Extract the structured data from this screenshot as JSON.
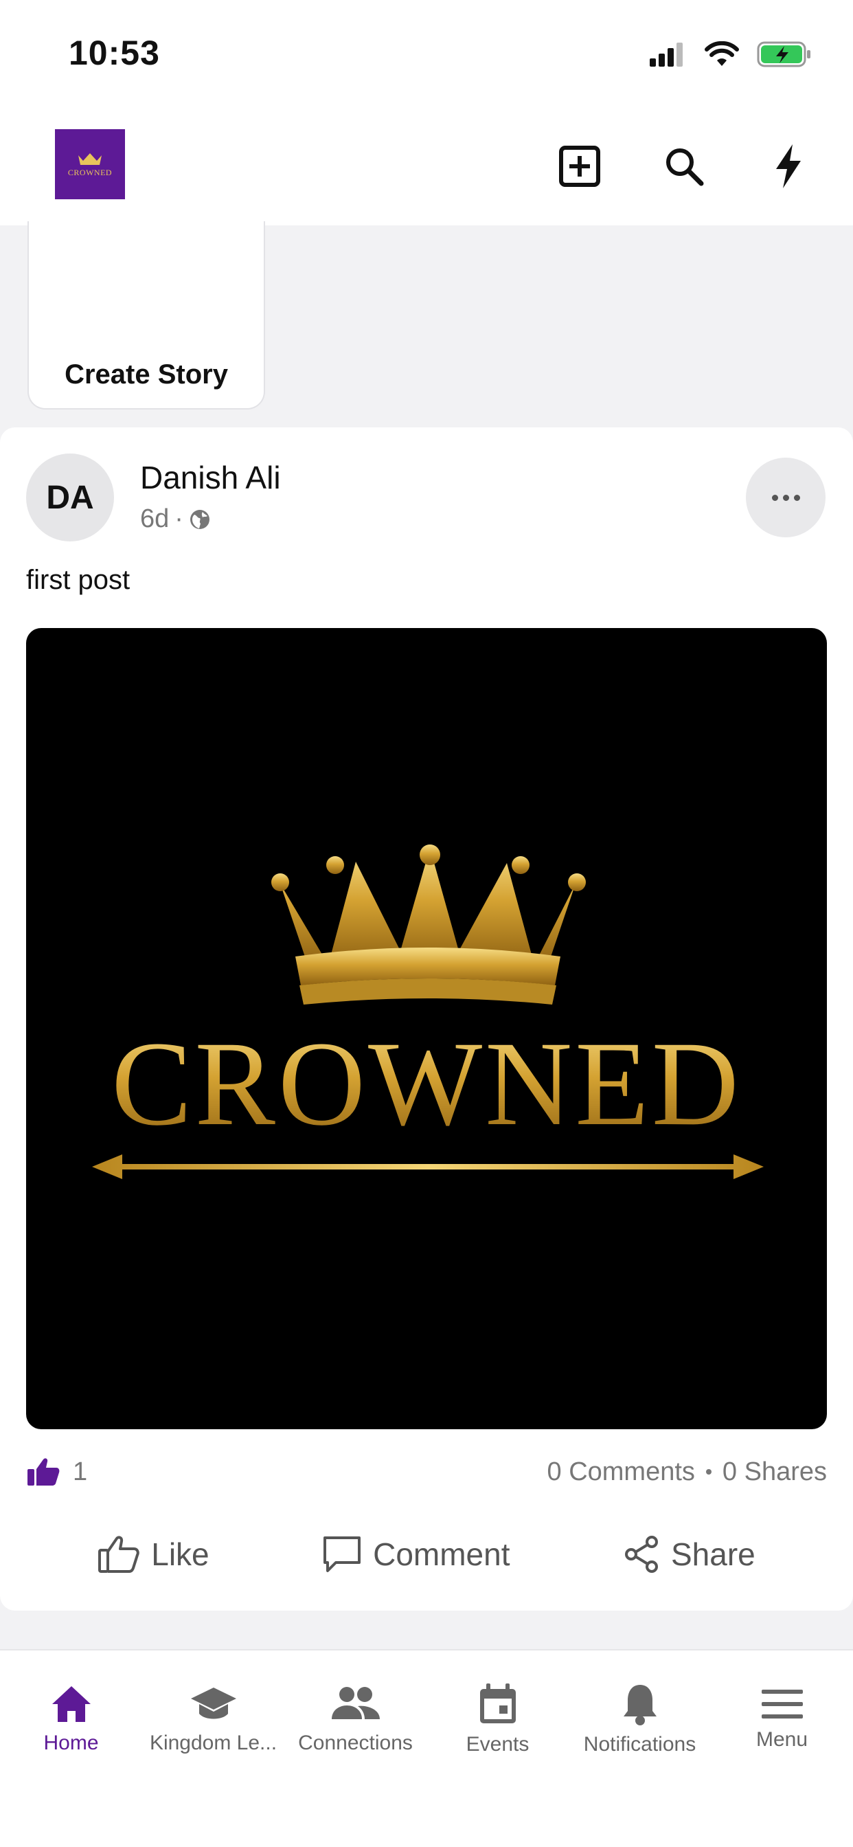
{
  "status_bar": {
    "time": "10:53"
  },
  "header": {
    "logo_text": "CROWNED",
    "actions": [
      "add-post",
      "search",
      "flash"
    ]
  },
  "stories": {
    "create_label": "Create Story"
  },
  "post": {
    "avatar_initials": "DA",
    "author": "Danish Ali",
    "age": "6d",
    "visibility": "public",
    "text": "first post",
    "image_text": "CROWNED",
    "likes": "1",
    "comments": "0 Comments",
    "shares": "0 Shares",
    "actions": {
      "like": "Like",
      "comment": "Comment",
      "share": "Share"
    }
  },
  "tab_bar": {
    "active": "Home",
    "tabs": [
      {
        "label": "Home",
        "icon": "home-icon"
      },
      {
        "label": "Kingdom Le...",
        "icon": "graduation-cap-icon"
      },
      {
        "label": "Connections",
        "icon": "people-icon"
      },
      {
        "label": "Events",
        "icon": "calendar-icon"
      },
      {
        "label": "Notifications",
        "icon": "bell-icon"
      },
      {
        "label": "Menu",
        "icon": "menu-icon"
      }
    ]
  },
  "colors": {
    "brand": "#5d1a96",
    "gold": "#d8aa3a"
  }
}
